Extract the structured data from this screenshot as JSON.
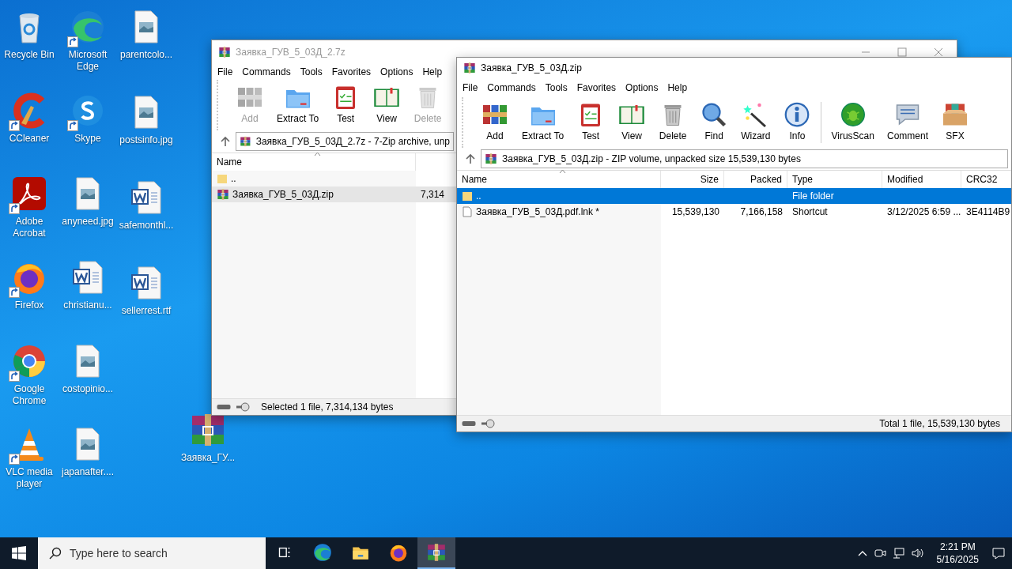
{
  "desktop_columns": [
    [
      {
        "label": "Recycle Bin",
        "kind": "recycle",
        "shortcut": false
      },
      {
        "label": "CCleaner",
        "kind": "ccleaner",
        "shortcut": true
      },
      {
        "label": "Adobe Acrobat",
        "kind": "acrobat",
        "shortcut": true
      },
      {
        "label": "Firefox",
        "kind": "firefox",
        "shortcut": true
      },
      {
        "label": "Google Chrome",
        "kind": "chrome",
        "shortcut": true
      },
      {
        "label": "VLC media player",
        "kind": "vlc",
        "shortcut": true
      }
    ],
    [
      {
        "label": "Microsoft Edge",
        "kind": "edge",
        "shortcut": true
      },
      {
        "label": "Skype",
        "kind": "skype",
        "shortcut": true
      },
      {
        "label": "anyneed.jpg",
        "kind": "image",
        "shortcut": false
      },
      {
        "label": "christianu...",
        "kind": "word",
        "shortcut": false
      },
      {
        "label": "costopinio...",
        "kind": "image",
        "shortcut": false
      },
      {
        "label": "japanafter....",
        "kind": "image",
        "shortcut": false
      }
    ],
    [
      {
        "label": "parentcolo...",
        "kind": "image",
        "shortcut": false
      },
      {
        "label": "postsinfo.jpg",
        "kind": "image",
        "shortcut": false
      },
      {
        "label": "safemonthl...",
        "kind": "word",
        "shortcut": false
      },
      {
        "label": "sellerrest.rtf",
        "kind": "word",
        "shortcut": false
      }
    ]
  ],
  "desktop_archive": {
    "label": "Заявка_ГУ...",
    "kind": "rar",
    "shortcut": false
  },
  "back_window": {
    "title": "Заявка_ГУВ_5_03Д_2.7z",
    "menu": [
      "File",
      "Commands",
      "Tools",
      "Favorites",
      "Options",
      "Help"
    ],
    "toolbar": [
      {
        "label": "Add",
        "kind": "add",
        "disabled": true
      },
      {
        "label": "Extract To",
        "kind": "extract",
        "disabled": false
      },
      {
        "label": "Test",
        "kind": "test",
        "disabled": false
      },
      {
        "label": "View",
        "kind": "view",
        "disabled": false
      },
      {
        "label": "Delete",
        "kind": "delete",
        "disabled": true
      }
    ],
    "path": "Заявка_ГУВ_5_03Д_2.7z - 7-Zip archive, unp",
    "columns": [
      "Name"
    ],
    "rows": [
      {
        "kind": "folder",
        "name": "..",
        "selected": false
      },
      {
        "kind": "archive",
        "name": "Заявка_ГУВ_5_03Д.zip",
        "size": "7,314",
        "selected": true
      }
    ],
    "status": "Selected 1 file, 7,314,134 bytes"
  },
  "front_window": {
    "title": "Заявка_ГУВ_5_03Д.zip",
    "menu": [
      "File",
      "Commands",
      "Tools",
      "Favorites",
      "Options",
      "Help"
    ],
    "toolbar_groups": [
      [
        {
          "label": "Add",
          "kind": "add",
          "disabled": false
        },
        {
          "label": "Extract To",
          "kind": "extract",
          "disabled": false
        },
        {
          "label": "Test",
          "kind": "test",
          "disabled": false
        },
        {
          "label": "View",
          "kind": "view",
          "disabled": false
        },
        {
          "label": "Delete",
          "kind": "delete",
          "disabled": false
        },
        {
          "label": "Find",
          "kind": "find",
          "disabled": false
        },
        {
          "label": "Wizard",
          "kind": "wizard",
          "disabled": false
        },
        {
          "label": "Info",
          "kind": "info",
          "disabled": false
        }
      ],
      [
        {
          "label": "VirusScan",
          "kind": "virus",
          "disabled": false
        },
        {
          "label": "Comment",
          "kind": "comment",
          "disabled": false
        },
        {
          "label": "SFX",
          "kind": "sfx",
          "disabled": false
        }
      ]
    ],
    "path": "Заявка_ГУВ_5_03Д.zip - ZIP volume, unpacked size 15,539,130 bytes",
    "columns": [
      "Name",
      "Size",
      "Packed",
      "Type",
      "Modified",
      "CRC32"
    ],
    "rows": [
      {
        "kind": "folder",
        "name": "..",
        "type": "File folder",
        "selected": true
      },
      {
        "kind": "shortcut",
        "name": "Заявка_ГУВ_5_03Д.pdf.lnk *",
        "size": "15,539,130",
        "packed": "7,166,158",
        "type": "Shortcut",
        "modified": "3/12/2025 6:59 ...",
        "crc": "3E4114B9",
        "selected": false
      }
    ],
    "status": "Total 1 file, 15,539,130 bytes"
  },
  "taskbar": {
    "search_placeholder": "Type here to search",
    "apps": [
      {
        "kind": "taskview",
        "active": false
      },
      {
        "kind": "edge",
        "active": false
      },
      {
        "kind": "explorer",
        "active": false
      },
      {
        "kind": "firefox",
        "active": false
      },
      {
        "kind": "rar",
        "active": true
      }
    ],
    "time": "2:21 PM",
    "date": "5/16/2025"
  }
}
